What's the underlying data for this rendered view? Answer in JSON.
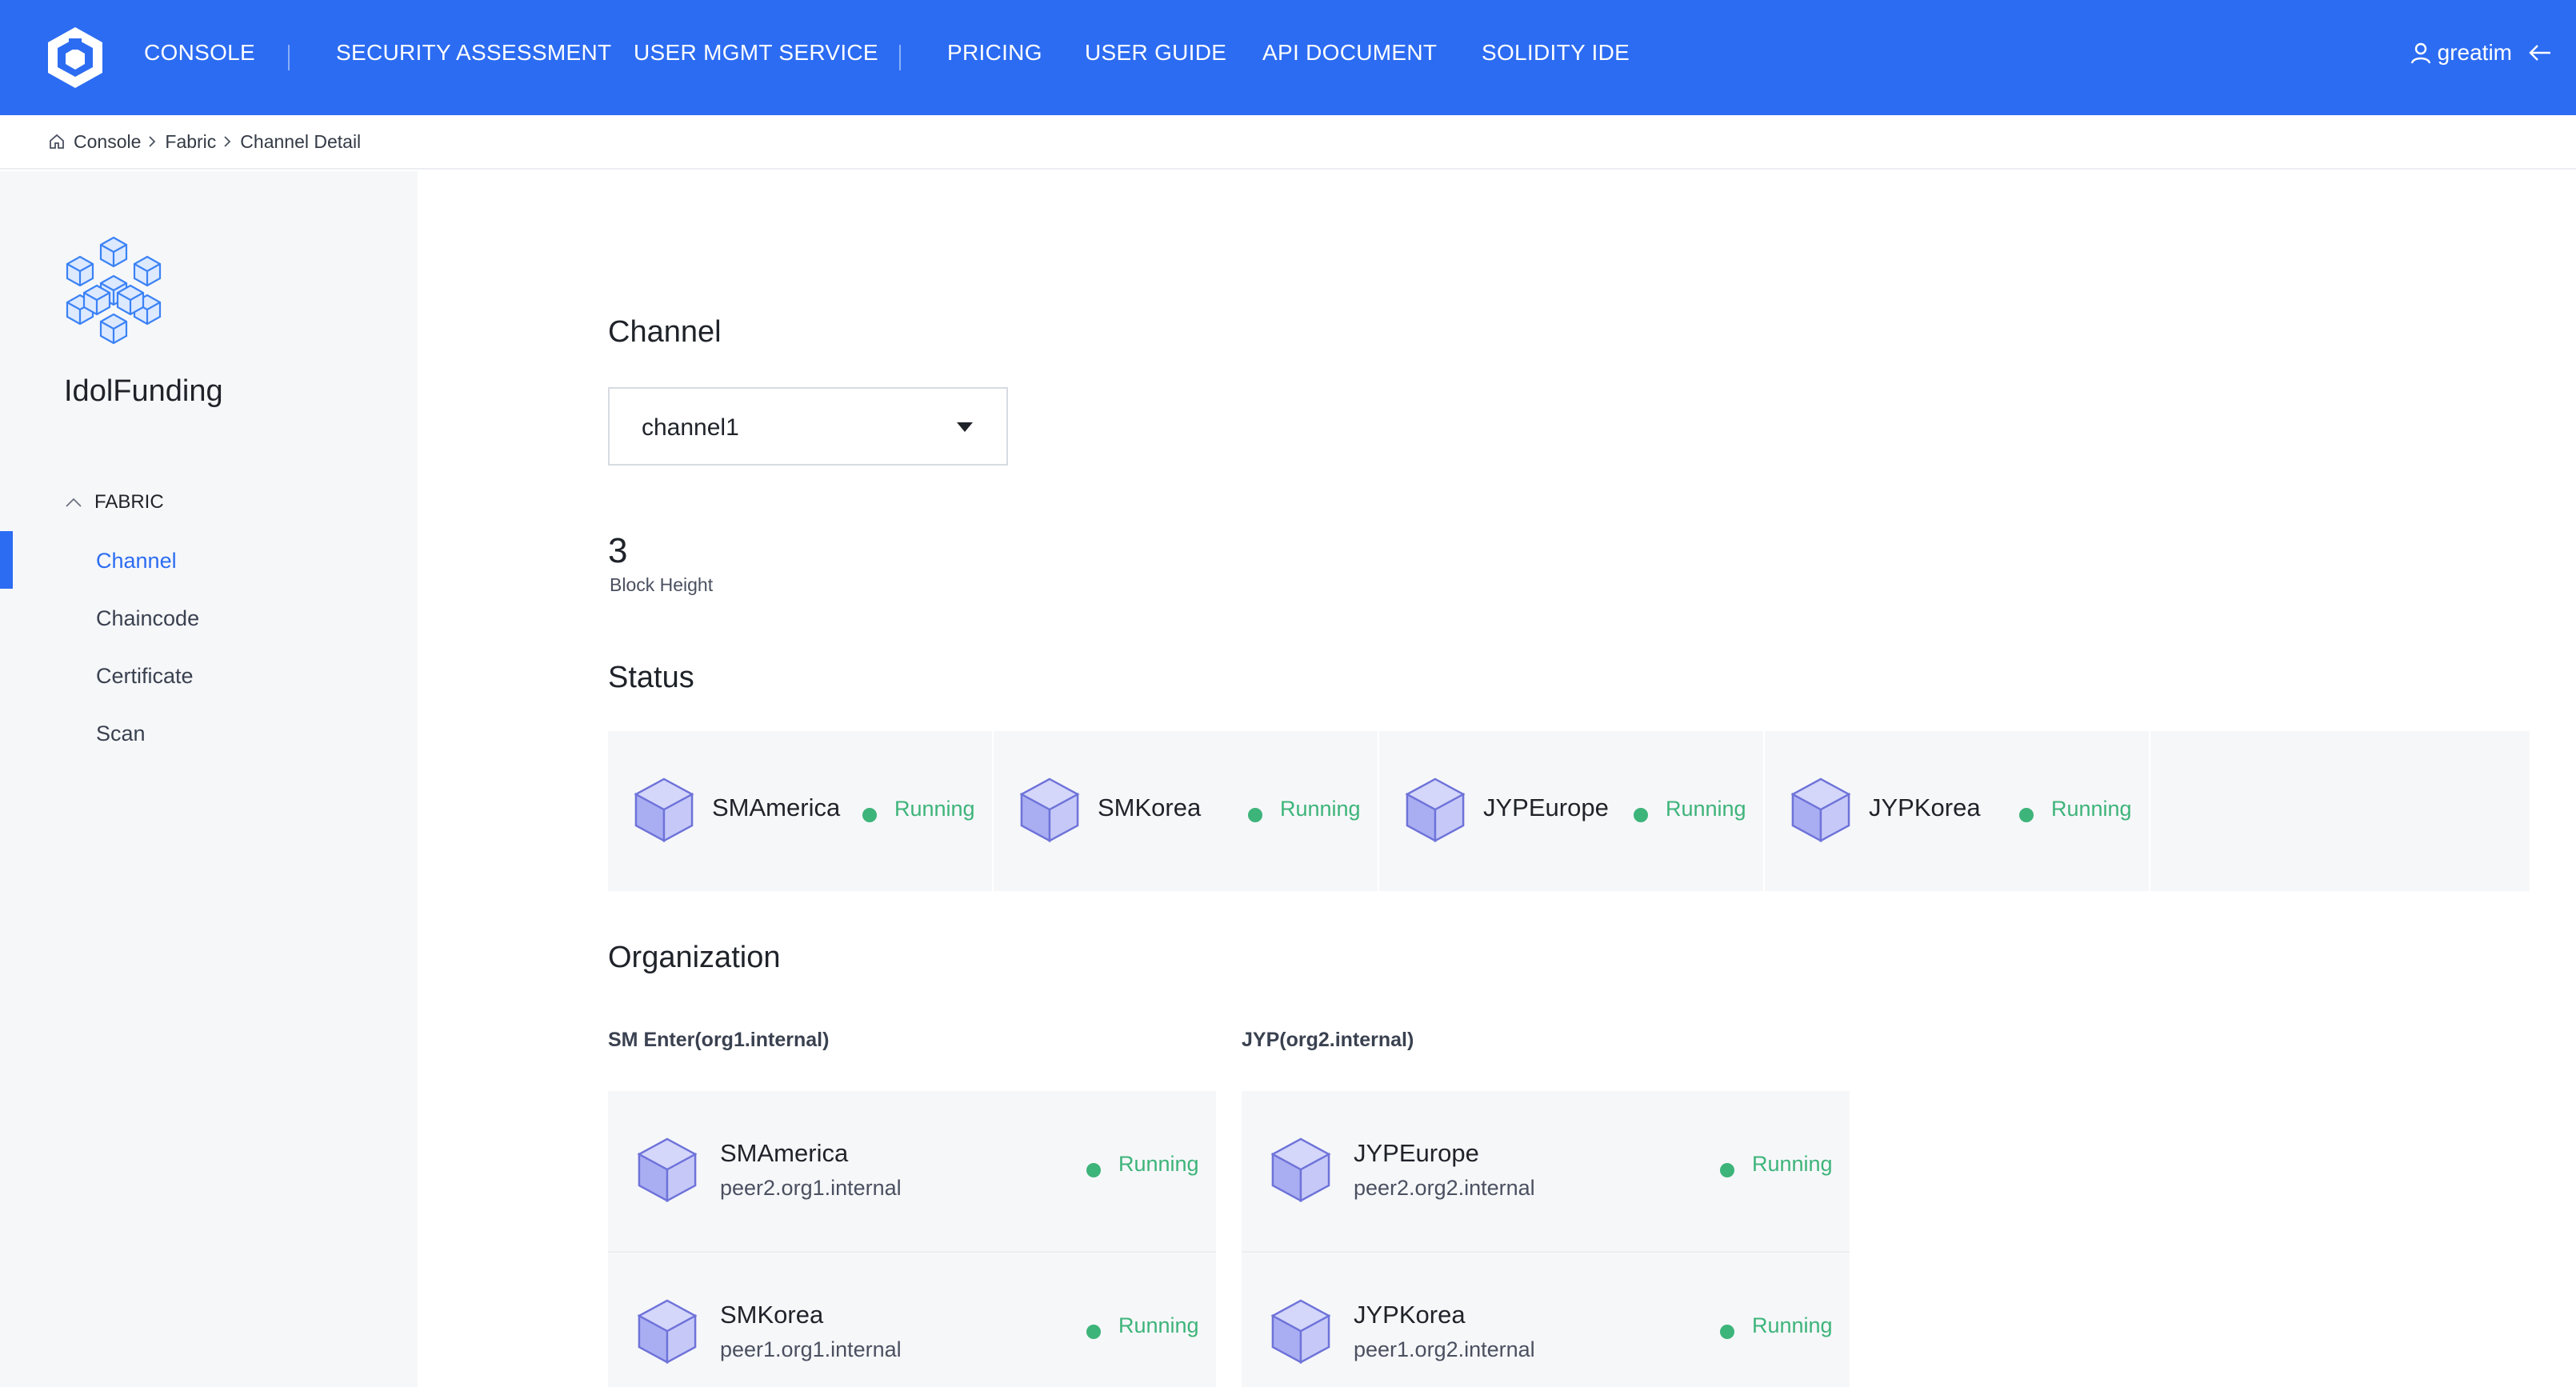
{
  "colors": {
    "brand": "#2c6cf2",
    "running": "#3db47a",
    "sidebar_bg": "#f6f7f9"
  },
  "header": {
    "nav": [
      {
        "label": "CONSOLE"
      },
      {
        "label": "SECURITY ASSESSMENT"
      },
      {
        "label": "USER MGMT SERVICE"
      },
      {
        "label": "PRICING"
      },
      {
        "label": "USER GUIDE"
      },
      {
        "label": "API DOCUMENT"
      },
      {
        "label": "SOLIDITY IDE"
      }
    ],
    "user": {
      "name": "greatim",
      "icon": "user-icon",
      "logout_icon": "logout-arrow-icon"
    }
  },
  "breadcrumb": {
    "home_icon": "home-icon",
    "items": [
      {
        "label": "Console"
      },
      {
        "label": "Fabric"
      },
      {
        "label": "Channel Detail"
      }
    ]
  },
  "sidebar": {
    "project_name": "IdolFunding",
    "group_label": "FABRIC",
    "items": [
      {
        "label": "Channel",
        "active": true
      },
      {
        "label": "Chaincode"
      },
      {
        "label": "Certificate"
      },
      {
        "label": "Scan"
      }
    ]
  },
  "main": {
    "channel": {
      "title": "Channel",
      "selected": "channel1"
    },
    "block_height": {
      "value": "3",
      "label": "Block Height"
    },
    "status": {
      "title": "Status",
      "items": [
        {
          "name": "SMAmerica",
          "state": "Running"
        },
        {
          "name": "SMKorea",
          "state": "Running"
        },
        {
          "name": "JYPEurope",
          "state": "Running"
        },
        {
          "name": "JYPKorea",
          "state": "Running"
        }
      ]
    },
    "organization": {
      "title": "Organization",
      "orgs": [
        {
          "label": "SM Enter(org1.internal)",
          "peers": [
            {
              "name": "SMAmerica",
              "host": "peer2.org1.internal",
              "state": "Running"
            },
            {
              "name": "SMKorea",
              "host": "peer1.org1.internal",
              "state": "Running"
            }
          ]
        },
        {
          "label": "JYP(org2.internal)",
          "peers": [
            {
              "name": "JYPEurope",
              "host": "peer2.org2.internal",
              "state": "Running"
            },
            {
              "name": "JYPKorea",
              "host": "peer1.org2.internal",
              "state": "Running"
            }
          ]
        }
      ]
    }
  }
}
